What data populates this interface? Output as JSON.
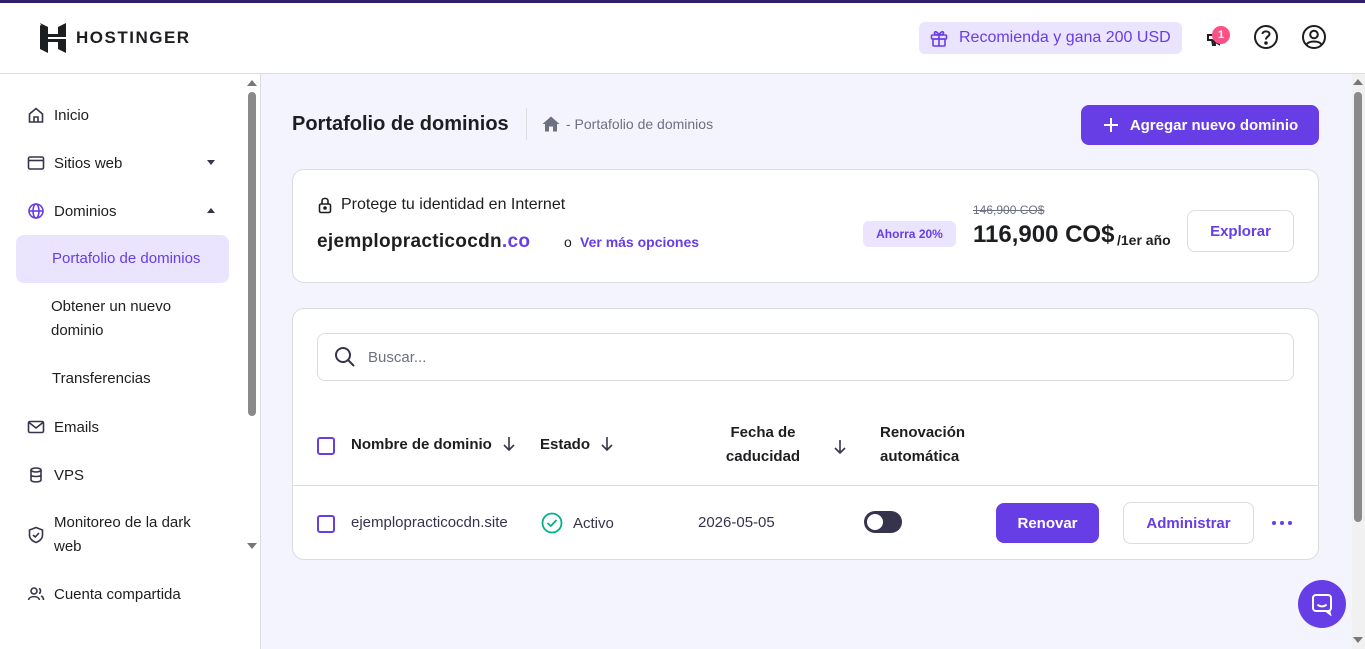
{
  "brand": {
    "name": "HOSTINGER"
  },
  "topbar": {
    "referral_label": "Recomienda y gana 200 USD",
    "notifications_count": "1"
  },
  "sidebar": {
    "items": [
      {
        "label": "Inicio",
        "icon": "home-icon"
      },
      {
        "label": "Sitios web",
        "icon": "browser-icon"
      },
      {
        "label": "Dominios",
        "icon": "globe-icon"
      },
      {
        "label": "Portafolio de dominios",
        "active": true
      },
      {
        "label": "Obtener un nuevo dominio"
      },
      {
        "label": "Transferencias"
      },
      {
        "label": "Emails",
        "icon": "mail-icon"
      },
      {
        "label": "VPS",
        "icon": "server-icon"
      },
      {
        "label": "Monitoreo de la dark web",
        "icon": "shield-icon"
      },
      {
        "label": "Cuenta compartida",
        "icon": "users-icon"
      }
    ]
  },
  "header": {
    "title": "Portafolio de dominios",
    "breadcrumb": "- Portafolio de dominios",
    "add_button": "Agregar nuevo dominio"
  },
  "promo": {
    "heading": "Protege tu identidad en Internet",
    "domain_name": "ejemplopracticocdn",
    "domain_tld": ".co",
    "or_text": "o",
    "more_options": "Ver más opciones",
    "save_badge": "Ahorra 20%",
    "old_price": "146,900 CO$",
    "price": "116,900 CO$",
    "period": "/1er año",
    "explore_button": "Explorar"
  },
  "table": {
    "search_placeholder": "Buscar...",
    "columns": {
      "name": "Nombre de dominio",
      "status": "Estado",
      "expiry": "Fecha de caducidad",
      "renewal": "Renovación automática"
    },
    "rows": [
      {
        "domain": "ejemplopracticocdn.site",
        "status": "Activo",
        "expiry": "2026-05-05",
        "auto_renew": false,
        "renew_button": "Renovar",
        "manage_button": "Administrar"
      }
    ]
  },
  "colors": {
    "accent": "#673de6",
    "accent_light": "#ebe4ff",
    "success": "#00b090"
  }
}
